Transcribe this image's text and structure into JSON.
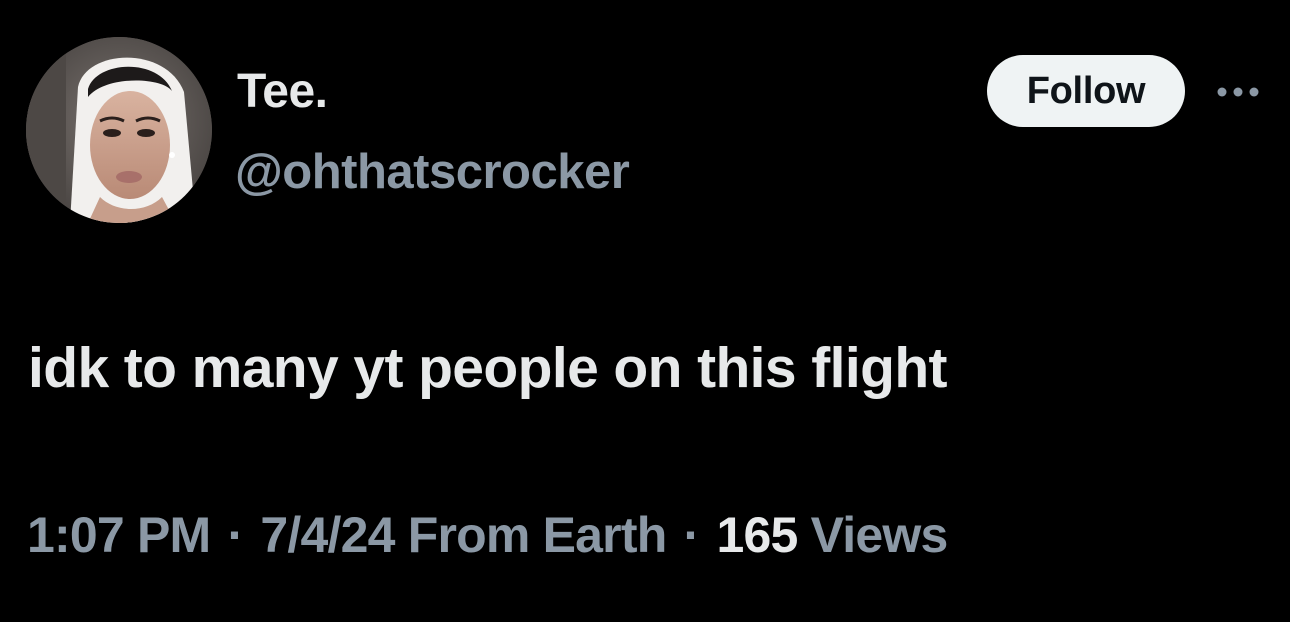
{
  "author": {
    "display_name": "Tee.",
    "handle": "@ohthatscrocker",
    "avatar_icon": "profile-photo"
  },
  "actions": {
    "follow_label": "Follow",
    "more_icon": "more-horizontal-icon"
  },
  "tweet": {
    "text": "idk to many yt people on this flight"
  },
  "meta": {
    "time": "1:07 PM",
    "separator": "·",
    "date": "7/4/24",
    "source": "From Earth",
    "views_count": "165",
    "views_label": "Views"
  },
  "colors": {
    "background": "#000000",
    "primary_text": "#e7e9ea",
    "secondary_text": "#8b98a5",
    "follow_bg": "#eff3f4",
    "follow_text": "#0f1419"
  }
}
